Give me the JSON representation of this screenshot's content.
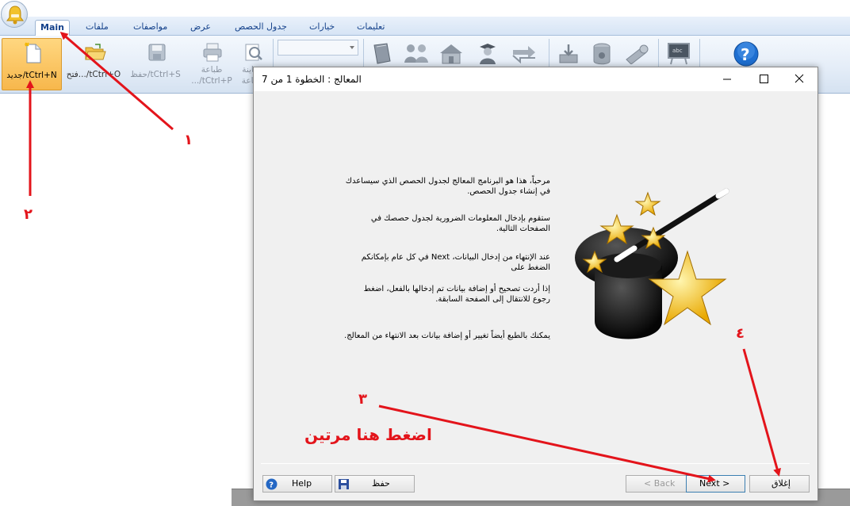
{
  "ribbon": {
    "tabs": [
      "Main",
      "ملفات",
      "مواصفات",
      "عرض",
      "جدول الحصص",
      "خيارات",
      "تعليمات"
    ],
    "active_tab": "Main",
    "buttons": {
      "new": "جديد/tCtrl+N",
      "open": "فتح.../tCtrl+O",
      "save": "حفظ/tCtrl+S",
      "print_line1": "طباعة",
      "print_line2": ".../tCtrl+P",
      "preview_line1": "معاينة",
      "preview_line2": "طباعة"
    },
    "combo_value": ""
  },
  "dialog": {
    "title": "المعالج : الخطوة 1 من 7",
    "paragraphs": [
      "مرحباً، هذا هو البرنامج المعالج لجدول الحصص الذي سيساعدك في إنشاء جدول الحصص.",
      "ستقوم بإدخال المعلومات الضرورية لجدول حصصك في الصفحات التالية.",
      "عند الإنتهاء من إدخال البيانات، Next في كل عام بإمكانكم الضغط على",
      "إذا أردت تصحيح أو إضافة بيانات تم إدخالها بالفعل، اضغط رجوع للانتقال إلى الصفحة السابقة.",
      "يمكنك بالطبع أيضاً تغيير أو إضافة بيانات بعد الانتهاء من المعالج."
    ],
    "buttons": {
      "help": "Help",
      "save": "حفظ",
      "back": "< Back",
      "next": "Next >",
      "close": "إغلاق"
    }
  },
  "annotations": {
    "marker_1": "١",
    "marker_2": "٢",
    "marker_3": "٣",
    "marker_4": "٤",
    "instruction": "اضغط هنا مرتين",
    "color": "#e3141b"
  },
  "colors": {
    "ribbon_bg": "#dfe9f5",
    "selected_button": "#f7b74c",
    "tab_text": "#15428b"
  }
}
